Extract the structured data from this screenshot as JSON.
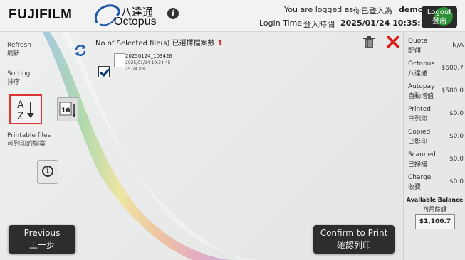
{
  "header": {
    "brand": "FUJIFILM",
    "octopus_cn": "八達通",
    "octopus_en": "Octopus",
    "logged_as_label": "You are logged as",
    "logged_as_cn": "你已登入為",
    "username": "demo",
    "login_time_label": "Login Time",
    "login_time_cn": "登入時間",
    "login_time": "2025/01/24 10:35:10",
    "logout_en": "Logout",
    "logout_cn": "登出"
  },
  "sidebar": {
    "refresh_en": "Refresh",
    "refresh_cn": "刷新",
    "sorting_en": "Sorting",
    "sorting_cn": "排序",
    "sort_az_glyph": "A↓Z",
    "sort_date_glyph": "16",
    "printable_en": "Printable files",
    "printable_cn": "可列印的檔案"
  },
  "selection": {
    "label": "No of Selected file(s) 已選擇檔案數",
    "count": "1"
  },
  "files": [
    {
      "name": "20250124_103426",
      "date": "2025/01/24 10:34:45",
      "size": "25.74 KB",
      "checked": true
    }
  ],
  "buttons": {
    "previous_en": "Previous",
    "previous_cn": "上一步",
    "confirm_en": "Confirm to Print",
    "confirm_cn": "確認列印"
  },
  "account": {
    "rows": [
      {
        "en": "Quota",
        "cn": "配額",
        "value": "N/A"
      },
      {
        "en": "Octopus",
        "cn": "八達通",
        "value": "$600.7"
      },
      {
        "en": "Autopay",
        "cn": "自動增值",
        "value": "$500.0"
      },
      {
        "en": "Printed",
        "cn": "已列印",
        "value": "$0.0"
      },
      {
        "en": "Copied",
        "cn": "已影印",
        "value": "$0.0"
      },
      {
        "en": "Scanned",
        "cn": "已掃描",
        "value": "$0.0"
      },
      {
        "en": "Charge",
        "cn": "收費",
        "value": "$0.0"
      }
    ],
    "available_en": "Available Balance",
    "available_cn": "可用餘額",
    "available_value": "$1,100.7"
  },
  "colors": {
    "accent_red": "#dd2222",
    "button_dark": "#2d2d2d",
    "logout_green": "#2e9a3a"
  }
}
